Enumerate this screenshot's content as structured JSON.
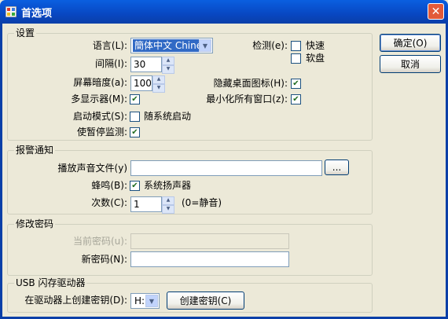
{
  "window": {
    "title": "首选项",
    "close_glyph": "✕"
  },
  "settings": {
    "group_title": "设置",
    "language_label": "语言(L):",
    "language_value": "簡体中文 Chines",
    "interval_label": "间隔(I):",
    "interval_value": "30",
    "dim_label": "屏幕暗度(a):",
    "dim_value": "100",
    "multi_monitor_label": "多显示器(M):",
    "multi_monitor_checked": true,
    "startup_label": "启动模式(S):",
    "startup_option": "随系统启动",
    "startup_checked": false,
    "pause_label": "使暂停监测:",
    "pause_checked": true,
    "detect_label": "检测(e):",
    "detect_fast": "快速",
    "detect_fast_checked": false,
    "detect_disk": "软盘",
    "detect_disk_checked": false,
    "hide_icon_label": "隐藏桌面图标(H):",
    "hide_icon_checked": true,
    "minimize_label": "最小化所有窗口(z):",
    "minimize_checked": true
  },
  "alarm": {
    "group_title": "报警通知",
    "sound_file_label": "播放声音文件(y)",
    "sound_file_value": "",
    "browse_label": "...",
    "beep_label": "蜂鸣(B):",
    "beep_option": "系统扬声器",
    "beep_checked": true,
    "count_label": "次数(C):",
    "count_value": "1",
    "count_hint": "(0=静音)"
  },
  "password": {
    "group_title": "修改密码",
    "current_label": "当前密码(u):",
    "new_label": "新密码(N):"
  },
  "usb": {
    "group_title": "USB 闪存驱动器",
    "drive_label": "在驱动器上创建密钥(D):",
    "drive_value": "H:",
    "create_button": "创建密钥(C)"
  },
  "buttons": {
    "ok": "确定(O)",
    "cancel": "取消"
  }
}
